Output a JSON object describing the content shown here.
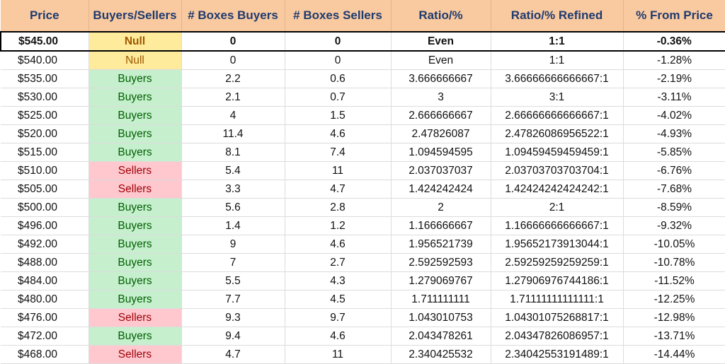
{
  "headers": [
    "Price",
    "Buyers/Sellers",
    "# Boxes Buyers",
    "# Boxes Sellers",
    "Ratio/%",
    "Ratio/% Refined",
    "% From Price"
  ],
  "colors": {
    "header_bg": "#f9c9a0",
    "header_text": "#1f3b6e",
    "null_bg": "#ffeb9c",
    "null_text": "#9c5700",
    "buyers_bg": "#c6efce",
    "buyers_text": "#006100",
    "sellers_bg": "#ffc7ce",
    "sellers_text": "#9c0006"
  },
  "rows": [
    {
      "price": "$545.00",
      "side": "Null",
      "buyers": "0",
      "sellers": "0",
      "ratio": "Even",
      "refined": "1:1",
      "from_price": "-0.36%",
      "current": true
    },
    {
      "price": "$540.00",
      "side": "Null",
      "buyers": "0",
      "sellers": "0",
      "ratio": "Even",
      "refined": "1:1",
      "from_price": "-1.28%"
    },
    {
      "price": "$535.00",
      "side": "Buyers",
      "buyers": "2.2",
      "sellers": "0.6",
      "ratio": "3.666666667",
      "refined": "3.66666666666667:1",
      "from_price": "-2.19%"
    },
    {
      "price": "$530.00",
      "side": "Buyers",
      "buyers": "2.1",
      "sellers": "0.7",
      "ratio": "3",
      "refined": "3:1",
      "from_price": "-3.11%"
    },
    {
      "price": "$525.00",
      "side": "Buyers",
      "buyers": "4",
      "sellers": "1.5",
      "ratio": "2.666666667",
      "refined": "2.66666666666667:1",
      "from_price": "-4.02%"
    },
    {
      "price": "$520.00",
      "side": "Buyers",
      "buyers": "11.4",
      "sellers": "4.6",
      "ratio": "2.47826087",
      "refined": "2.47826086956522:1",
      "from_price": "-4.93%"
    },
    {
      "price": "$515.00",
      "side": "Buyers",
      "buyers": "8.1",
      "sellers": "7.4",
      "ratio": "1.094594595",
      "refined": "1.09459459459459:1",
      "from_price": "-5.85%"
    },
    {
      "price": "$510.00",
      "side": "Sellers",
      "buyers": "5.4",
      "sellers": "11",
      "ratio": "2.037037037",
      "refined": "2.03703703703704:1",
      "from_price": "-6.76%"
    },
    {
      "price": "$505.00",
      "side": "Sellers",
      "buyers": "3.3",
      "sellers": "4.7",
      "ratio": "1.424242424",
      "refined": "1.42424242424242:1",
      "from_price": "-7.68%"
    },
    {
      "price": "$500.00",
      "side": "Buyers",
      "buyers": "5.6",
      "sellers": "2.8",
      "ratio": "2",
      "refined": "2:1",
      "from_price": "-8.59%"
    },
    {
      "price": "$496.00",
      "side": "Buyers",
      "buyers": "1.4",
      "sellers": "1.2",
      "ratio": "1.166666667",
      "refined": "1.16666666666667:1",
      "from_price": "-9.32%"
    },
    {
      "price": "$492.00",
      "side": "Buyers",
      "buyers": "9",
      "sellers": "4.6",
      "ratio": "1.956521739",
      "refined": "1.95652173913044:1",
      "from_price": "-10.05%"
    },
    {
      "price": "$488.00",
      "side": "Buyers",
      "buyers": "7",
      "sellers": "2.7",
      "ratio": "2.592592593",
      "refined": "2.59259259259259:1",
      "from_price": "-10.78%"
    },
    {
      "price": "$484.00",
      "side": "Buyers",
      "buyers": "5.5",
      "sellers": "4.3",
      "ratio": "1.279069767",
      "refined": "1.27906976744186:1",
      "from_price": "-11.52%"
    },
    {
      "price": "$480.00",
      "side": "Buyers",
      "buyers": "7.7",
      "sellers": "4.5",
      "ratio": "1.711111111",
      "refined": "1.71111111111111:1",
      "from_price": "-12.25%"
    },
    {
      "price": "$476.00",
      "side": "Sellers",
      "buyers": "9.3",
      "sellers": "9.7",
      "ratio": "1.043010753",
      "refined": "1.04301075268817:1",
      "from_price": "-12.98%"
    },
    {
      "price": "$472.00",
      "side": "Buyers",
      "buyers": "9.4",
      "sellers": "4.6",
      "ratio": "2.043478261",
      "refined": "2.04347826086957:1",
      "from_price": "-13.71%"
    },
    {
      "price": "$468.00",
      "side": "Sellers",
      "buyers": "4.7",
      "sellers": "11",
      "ratio": "2.340425532",
      "refined": "2.34042553191489:1",
      "from_price": "-14.44%"
    }
  ]
}
